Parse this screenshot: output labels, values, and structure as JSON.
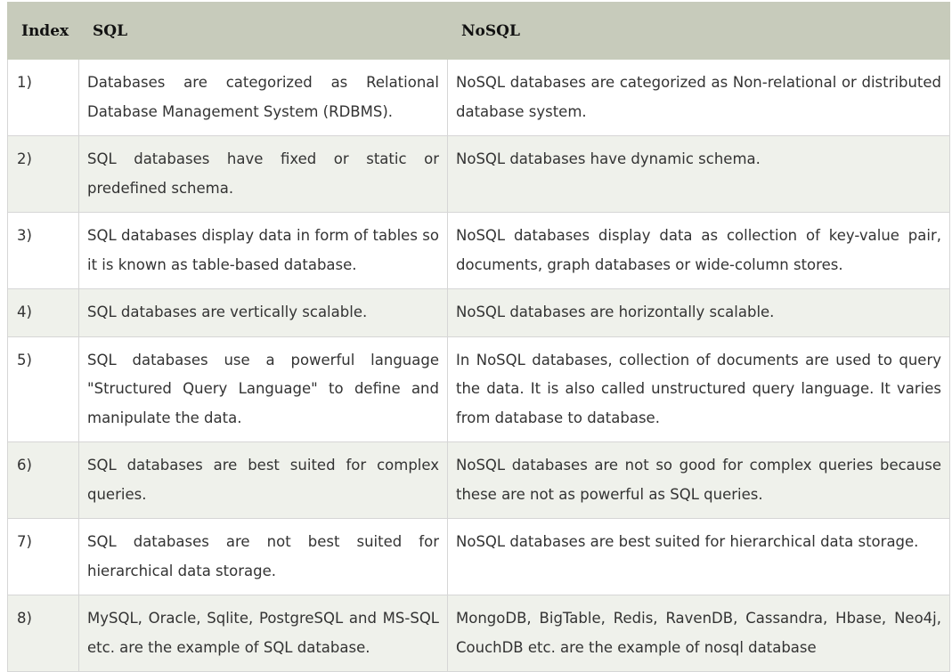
{
  "table": {
    "headers": [
      "Index",
      "SQL",
      "NoSQL"
    ],
    "rows": [
      {
        "index": "1)",
        "sql": "Databases are categorized as Relational Database Management System (RDBMS).",
        "nosql": "NoSQL databases are categorized as Non-relational or distributed database system."
      },
      {
        "index": "2)",
        "sql": "SQL databases have fixed or static or predefined schema.",
        "nosql": "NoSQL databases have dynamic schema."
      },
      {
        "index": "3)",
        "sql": "SQL databases display data in form of tables so it is known as table-based database.",
        "nosql": "NoSQL databases display data as collection of key-value pair, documents, graph databases or wide-column stores."
      },
      {
        "index": "4)",
        "sql": "SQL databases are vertically scalable.",
        "nosql": "NoSQL databases are horizontally scalable."
      },
      {
        "index": "5)",
        "sql": "SQL databases use a powerful language \"Structured Query Language\" to define and manipulate the data.",
        "nosql": "In NoSQL databases, collection of documents are used to query the data. It is also called unstructured query language. It varies from database to database."
      },
      {
        "index": "6)",
        "sql": "SQL databases are best suited for complex queries.",
        "nosql": "NoSQL databases are not so good for complex queries because these are not as powerful as SQL queries."
      },
      {
        "index": "7)",
        "sql": "SQL databases are not best suited for hierarchical data storage.",
        "nosql": "NoSQL databases are best suited for hierarchical data storage."
      },
      {
        "index": "8)",
        "sql": "MySQL, Oracle, Sqlite, PostgreSQL and MS-SQL etc. are the example of SQL database.",
        "nosql": "MongoDB, BigTable, Redis, RavenDB, Cassandra, Hbase, Neo4j, CouchDB etc. are the example of nosql database"
      }
    ]
  }
}
